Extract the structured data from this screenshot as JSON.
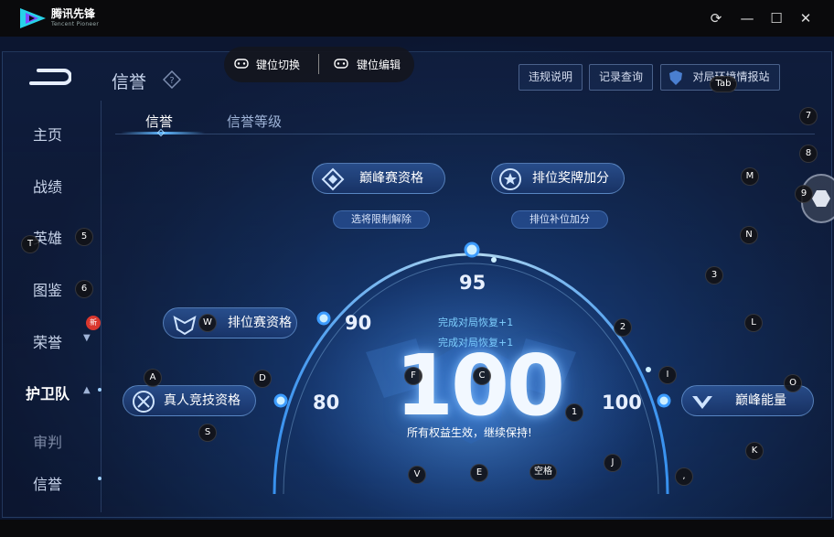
{
  "app": {
    "name": "腾讯先锋",
    "subname": "Tencent Pioneer",
    "controls": {
      "refresh": "⟳",
      "minimize": "—",
      "maximize": "☐",
      "close": "✕"
    }
  },
  "keybar": {
    "switch_label": "键位切换",
    "edit_label": "键位编辑"
  },
  "header": {
    "title": "信誉",
    "help": "?",
    "buttons": {
      "rules": "违规说明",
      "records": "记录查询",
      "report": "对局环境情报站"
    }
  },
  "nav": {
    "items": [
      "主页",
      "战绩",
      "英雄",
      "图鉴",
      "荣誉",
      "护卫队",
      "审判",
      "信誉"
    ],
    "new_badge": "新"
  },
  "tabs": {
    "credit": "信誉",
    "credit_level": "信誉等级"
  },
  "privileges": {
    "peak_qualification": "巅峰赛资格",
    "peak_sub": "选将限制解除",
    "rank_medal": "排位奖牌加分",
    "rank_sub": "排位补位加分",
    "rank_qualification": "排位赛资格",
    "pvp_qualification": "真人竞技资格",
    "peak_energy": "巅峰能量"
  },
  "scores": {
    "current": "100",
    "s80": "80",
    "s90": "90",
    "s95": "95",
    "s100": "100",
    "recover1": "完成对局恢复+1",
    "recover2": "完成对局恢复+1",
    "caption": "所有权益生效，继续保持!"
  },
  "keys": {
    "tab": "Tab",
    "k7": "7",
    "k8": "8",
    "k9": "9",
    "M": "M",
    "N": "N",
    "k3": "3",
    "L": "L",
    "k2": "2",
    "I": "I",
    "O": "O",
    "K": "K",
    "J": "J",
    "comma": ",",
    "space": "空格",
    "E": "E",
    "V": "V",
    "k1": "1",
    "F": "F",
    "C": "C",
    "D": "D",
    "A": "A",
    "S": "S",
    "W": "W",
    "T": "T",
    "k5": "5",
    "k6": "6"
  },
  "colors": {
    "accent": "#5fb7ff",
    "badge": "#d9372e",
    "background": "#112a55"
  }
}
